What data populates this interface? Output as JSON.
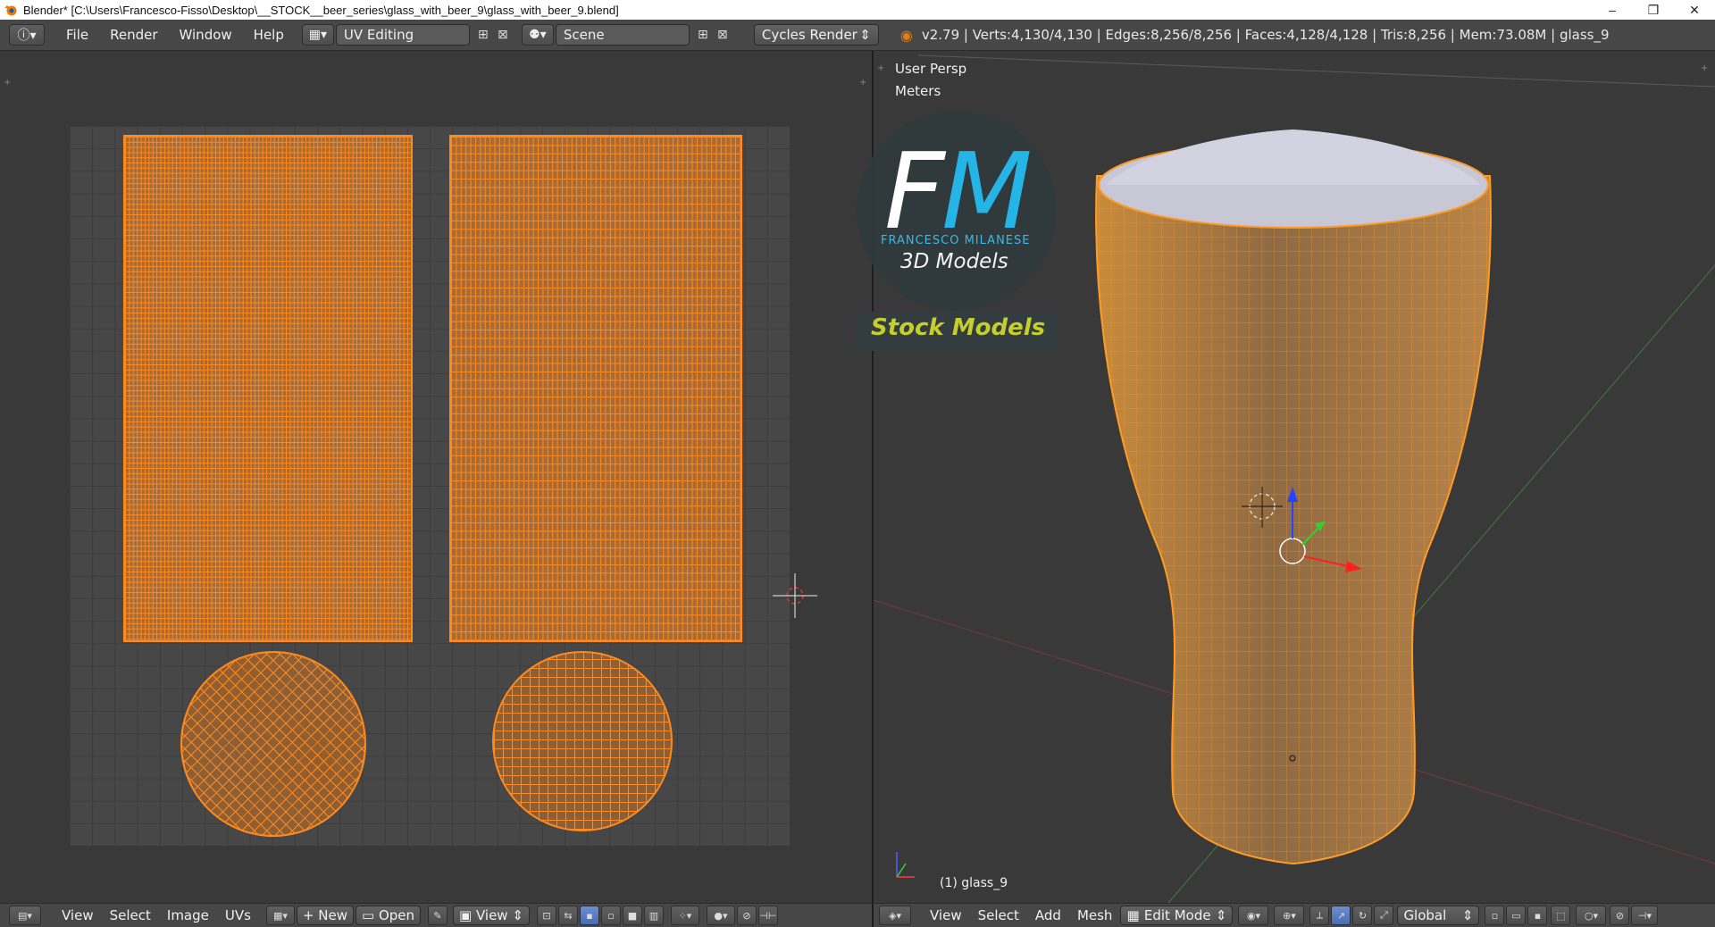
{
  "window": {
    "title": "Blender* [C:\\Users\\Francesco-Fisso\\Desktop\\__STOCK__beer_series\\glass_with_beer_9\\glass_with_beer_9.blend]",
    "minimize": "–",
    "maximize": "❐",
    "close": "✕"
  },
  "topbar": {
    "menus": [
      "File",
      "Render",
      "Window",
      "Help"
    ],
    "screen_layout": "UV Editing",
    "scene": "Scene",
    "render_engine": "Cycles Render",
    "stats": "v2.79 | Verts:4,130/4,130 | Edges:8,256/8,256 | Faces:4,128/4,128 | Tris:8,256 | Mem:73.08M | glass_9"
  },
  "uv_editor": {
    "menus": [
      "View",
      "Select",
      "Image",
      "UVs"
    ],
    "new_label": "New",
    "open_label": "Open",
    "view_label": "View"
  },
  "viewport": {
    "view_name": "User Persp",
    "units": "Meters",
    "object_label": "(1) glass_9",
    "menus": [
      "View",
      "Select",
      "Add",
      "Mesh"
    ],
    "mode": "Edit Mode",
    "orientation": "Global"
  },
  "logo": {
    "f": "F",
    "m": "M",
    "name": "FRANCESCO MILANESE",
    "subtitle": "3D Models",
    "stock": "Stock Models"
  },
  "colors": {
    "uv_selected": "#ff8a1e",
    "logo_blue": "#25b4e6",
    "logo_stock": "#c4cf2c"
  }
}
